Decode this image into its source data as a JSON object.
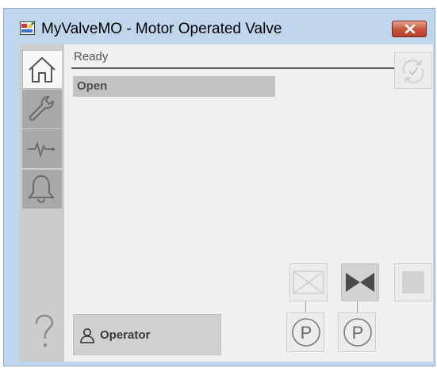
{
  "window": {
    "title": "MyValveMO - Motor Operated Valve",
    "icon": "valve-faceplate-app-icon",
    "close_icon": "close-x-icon"
  },
  "nav": {
    "tabs": [
      {
        "name": "home",
        "icon": "home-icon",
        "selected": true
      },
      {
        "name": "maintenance",
        "icon": "wrench-icon",
        "selected": false
      },
      {
        "name": "trends",
        "icon": "trend-pulse-icon",
        "selected": false
      },
      {
        "name": "alarms",
        "icon": "bell-icon",
        "selected": false
      }
    ],
    "help_label": "?"
  },
  "main": {
    "status": "Ready",
    "state": "Open",
    "refresh_icon": "refresh-icon",
    "controls": [
      {
        "name": "close-valve",
        "icon": "valve-closed-icon",
        "enabled": false
      },
      {
        "name": "open-valve",
        "icon": "valve-open-icon",
        "enabled": true
      },
      {
        "name": "stop",
        "icon": "stop-icon",
        "enabled": false
      }
    ],
    "priority_label": "P",
    "operator_label": "Operator"
  },
  "colors": {
    "window_frame": "#bfd6ec",
    "client_bg": "#f0f0f0",
    "nav_bg": "#cdcdcd",
    "state_bar": "#c2c2c2",
    "close_red": "#c8513a"
  }
}
